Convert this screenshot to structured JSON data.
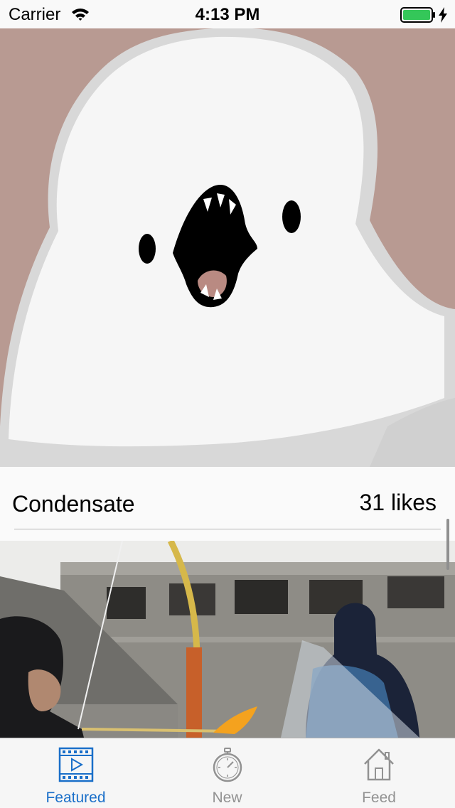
{
  "status_bar": {
    "carrier": "Carrier",
    "time": "4:13 PM",
    "battery_color": "#34c759"
  },
  "feed": {
    "posts": [
      {
        "title": "Condensate",
        "likes": "31 likes",
        "image": "ghost-cartoon-illustration"
      },
      {
        "image": "archers-in-front-of-ruined-building-photo"
      }
    ]
  },
  "tab_bar": {
    "active_color": "#1a6fc9",
    "inactive_color": "#929292",
    "tabs": [
      {
        "label": "Featured",
        "icon": "film-play-icon",
        "active": true
      },
      {
        "label": "New",
        "icon": "stopwatch-icon",
        "active": false
      },
      {
        "label": "Feed",
        "icon": "house-icon",
        "active": false
      }
    ]
  }
}
